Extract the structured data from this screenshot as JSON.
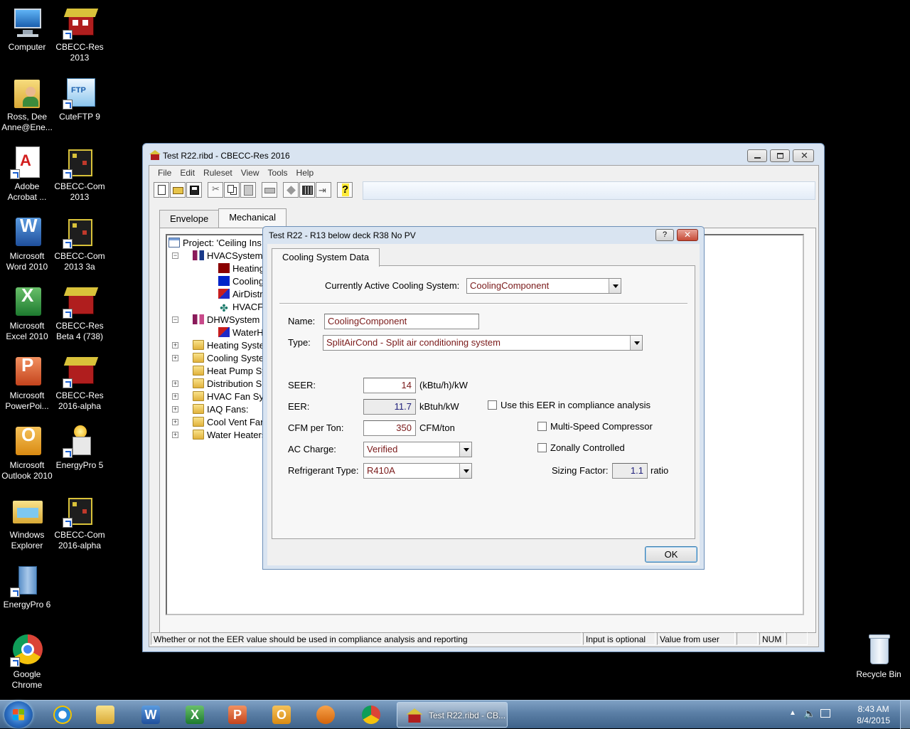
{
  "desktop": {
    "icons": [
      {
        "label": "Computer",
        "icon": "computer-icon"
      },
      {
        "label": "CBECC-Res 2013",
        "icon": "cbecc-icon"
      },
      {
        "label": "Ross, Dee Anne@Ene...",
        "icon": "user-folder-icon"
      },
      {
        "label": "CuteFTP 9",
        "icon": "cuteftp-icon"
      },
      {
        "label": "Adobe Acrobat ...",
        "icon": "acrobat-icon"
      },
      {
        "label": "CBECC-Com 2013",
        "icon": "cbecc-icon"
      },
      {
        "label": "Microsoft Word 2010",
        "icon": "word-icon"
      },
      {
        "label": "CBECC-Com 2013 3a",
        "icon": "cbecc-icon"
      },
      {
        "label": "Microsoft Excel 2010",
        "icon": "excel-icon"
      },
      {
        "label": "CBECC-Res Beta 4 (738)",
        "icon": "cbecc-icon"
      },
      {
        "label": "Microsoft PowerPoi...",
        "icon": "powerpoint-icon"
      },
      {
        "label": "CBECC-Res 2016-alpha",
        "icon": "cbecc-icon"
      },
      {
        "label": "Microsoft Outlook 2010",
        "icon": "outlook-icon"
      },
      {
        "label": "EnergyPro 5",
        "icon": "energypro-icon"
      },
      {
        "label": "Windows Explorer",
        "icon": "explorer-icon"
      },
      {
        "label": "CBECC-Com 2016-alpha",
        "icon": "cbecc-icon"
      },
      {
        "label": "EnergyPro 6",
        "icon": "energypro-icon"
      },
      {
        "label": "Google Chrome",
        "icon": "chrome-icon"
      },
      {
        "label": "Recycle Bin",
        "icon": "recycle-bin-icon"
      }
    ]
  },
  "main_window": {
    "title": "Test R22.ribd - CBECC-Res 2016",
    "menu": [
      "File",
      "Edit",
      "Ruleset",
      "View",
      "Tools",
      "Help"
    ],
    "tabs": [
      "Envelope",
      "Mechanical"
    ],
    "active_tab": "Mechanical",
    "tree": [
      {
        "label": "Project:  'Ceiling Ins",
        "icon": "project-icon"
      },
      {
        "label": "HVACSystem",
        "icon": "hvac-system-icon"
      },
      {
        "label": "Heating",
        "icon": "heating-icon"
      },
      {
        "label": "Cooling",
        "icon": "cooling-icon"
      },
      {
        "label": "AirDistri",
        "icon": "air-distribution-icon"
      },
      {
        "label": "HVACF",
        "icon": "fan-icon"
      },
      {
        "label": "DHWSystem",
        "icon": "dhw-system-icon"
      },
      {
        "label": "WaterH",
        "icon": "water-heater-icon"
      },
      {
        "label": "Heating Syste",
        "icon": "folder-icon"
      },
      {
        "label": "Cooling Syste",
        "icon": "folder-icon"
      },
      {
        "label": "Heat Pump Sy",
        "icon": "folder-icon"
      },
      {
        "label": "Distribution S",
        "icon": "folder-icon"
      },
      {
        "label": "HVAC Fan Sy",
        "icon": "folder-icon"
      },
      {
        "label": "IAQ Fans:",
        "icon": "folder-icon"
      },
      {
        "label": "Cool Vent Far",
        "icon": "folder-icon"
      },
      {
        "label": "Water Heaters",
        "icon": "folder-icon"
      }
    ],
    "status": {
      "message": "Whether or not the EER value should be used in compliance analysis and reporting",
      "input": "Input is optional",
      "source": "Value from user",
      "blank": "",
      "num": "NUM"
    }
  },
  "dialog": {
    "title": "Test R22 - R13 below deck R38 No PV",
    "help": "?",
    "tab": "Cooling System Data",
    "active_system_label": "Currently Active Cooling System:",
    "active_system_value": "CoolingComponent",
    "name_label": "Name:",
    "name_value": "CoolingComponent",
    "type_label": "Type:",
    "type_value": "SplitAirCond - Split air conditioning system",
    "seer_label": "SEER:",
    "seer_value": "14",
    "seer_unit": "(kBtu/h)/kW",
    "eer_label": "EER:",
    "eer_value": "11.7",
    "eer_unit": "kBtuh/kW",
    "use_eer_label": "Use this EER in compliance analysis",
    "cfm_label": "CFM per Ton:",
    "cfm_value": "350",
    "cfm_unit": "CFM/ton",
    "multispeed_label": "Multi-Speed Compressor",
    "ac_charge_label": "AC Charge:",
    "ac_charge_value": "Verified",
    "zonally_label": "Zonally Controlled",
    "refrigerant_label": "Refrigerant Type:",
    "refrigerant_value": "R410A",
    "sizing_label": "Sizing Factor:",
    "sizing_value": "1.1",
    "sizing_unit": "ratio",
    "ok": "OK"
  },
  "taskbar": {
    "active_window": "Test R22.ribd - CB...",
    "time": "8:43 AM",
    "date": "8/4/2015"
  }
}
